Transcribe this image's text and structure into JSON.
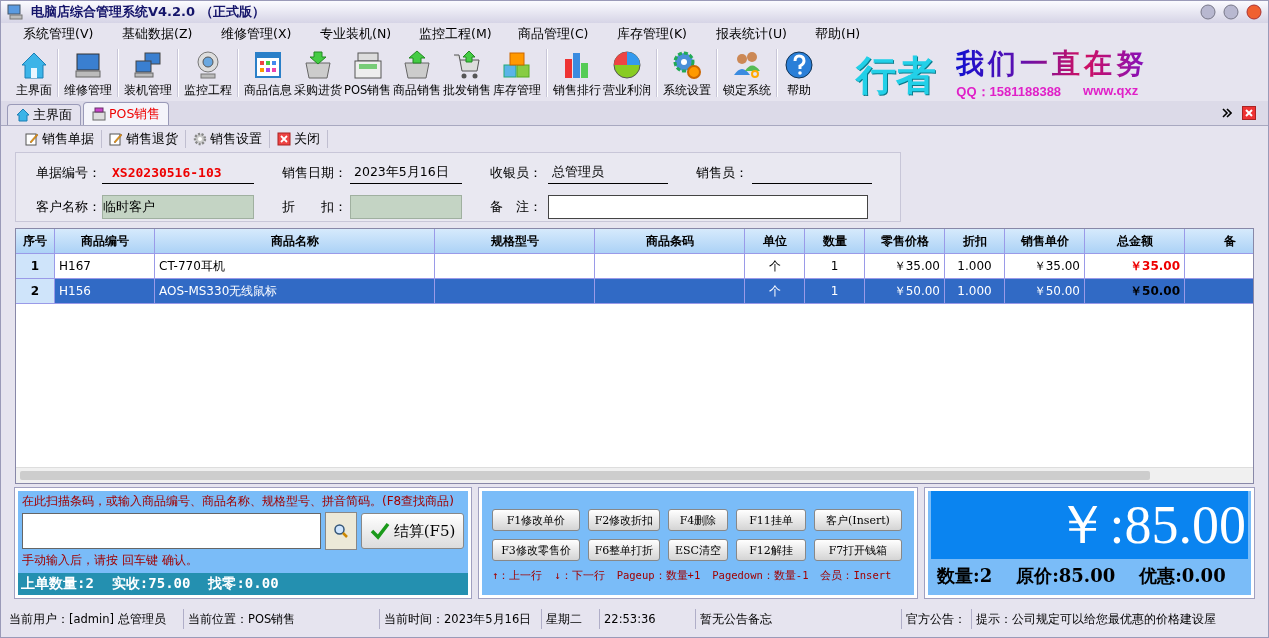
{
  "window": {
    "title": "电脑店综合管理系统V4.2.0 （正式版）"
  },
  "menu": [
    "系统管理(V)",
    "基础数据(Z)",
    "维修管理(X)",
    "专业装机(N)",
    "监控工程(M)",
    "商品管理(C)",
    "库存管理(K)",
    "报表统计(U)",
    "帮助(H)"
  ],
  "toolbar": [
    "主界面",
    "维修管理",
    "装机管理",
    "监控工程",
    "商品信息",
    "采购进货",
    "POS销售",
    "商品销售",
    "批发销售",
    "库存管理",
    "销售排行",
    "营业利润",
    "系统设置",
    "锁定系统",
    "帮助"
  ],
  "banner": {
    "brand": "行者",
    "slogan": "我们一直在努",
    "qq": "QQ：1581188388",
    "site": "www.qxz"
  },
  "tabs": [
    {
      "label": "主界面",
      "selected": false
    },
    {
      "label": "POS销售",
      "selected": true
    }
  ],
  "actions": [
    "销售单据",
    "销售退货",
    "销售设置",
    "关闭"
  ],
  "form": {
    "rows": [
      [
        {
          "label": "单据编号：",
          "kind": "code",
          "value": "XS20230516-103"
        },
        {
          "label": "销售日期：",
          "kind": "line",
          "value": "2023年5月16日"
        },
        {
          "label": "收银员：",
          "kind": "line",
          "value": "总管理员"
        },
        {
          "label": "销售员：",
          "kind": "line"
        }
      ],
      [
        {
          "label": "客户名称：",
          "kind": "filled",
          "value": "临时客户"
        },
        {
          "label": "折　　扣：",
          "kind": "filled"
        },
        {
          "label": "备　注：",
          "kind": "input"
        }
      ]
    ]
  },
  "table": {
    "columns": [
      "序号",
      "商品编号",
      "商品名称",
      "规格型号",
      "商品条码",
      "单位",
      "数量",
      "零售价格",
      "折扣",
      "销售单价",
      "总金额",
      "备"
    ],
    "rows": [
      {
        "selected": false,
        "cells": [
          "1",
          "H167",
          "CT-770耳机",
          "",
          "",
          "个",
          "1",
          "￥35.00",
          "1.000",
          "￥35.00",
          "￥35.00",
          ""
        ]
      },
      {
        "selected": true,
        "cells": [
          "2",
          "H156",
          "AOS-MS330无线鼠标",
          "",
          "",
          "个",
          "1",
          "￥50.00",
          "1.000",
          "￥50.00",
          "￥50.00",
          ""
        ]
      }
    ]
  },
  "scan": {
    "hint": "在此扫描条码，或输入商品编号、商品名称、规格型号、拼音简码。(F8查找商品)",
    "settle": "结算(F5)",
    "tip": "手动输入后，请按 回车键 确认。",
    "summary": [
      "上单数量:2",
      "实收:75.00",
      "找零:0.00"
    ]
  },
  "keys": {
    "buttons": [
      "F1修改单价",
      "F2修改折扣",
      "F4删除",
      "F11挂单",
      "客户(Insert)",
      "F3修改零售价",
      "F6整单打折",
      "ESC清空",
      "F12解挂",
      "F7打开钱箱"
    ],
    "hints": [
      "↑：上一行",
      "↓：下一行",
      "Pageup：数量+1",
      "Pagedown：数量-1",
      "会员：Insert"
    ]
  },
  "total": {
    "amount": "￥:85.00",
    "stats": [
      "数量:2",
      "原价:85.00",
      "优惠:0.00"
    ]
  },
  "status_bar": [
    "当前用户：[admin] 总管理员",
    "当前位置：POS销售",
    "当前时间：2023年5月16日",
    "星期二",
    "22:53:36",
    "暂无公告备忘",
    "官方公告：",
    "提示：公司规定可以给您最优惠的价格建设屋"
  ]
}
